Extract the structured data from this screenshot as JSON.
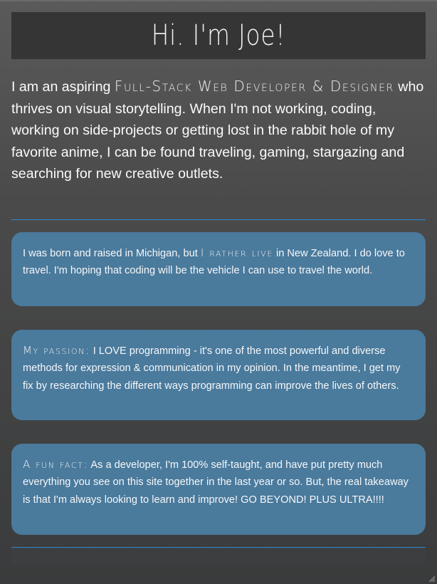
{
  "hero": {
    "title": "Hi. I'm Joe!"
  },
  "intro": {
    "text_before": "I am an aspiring ",
    "highlight": "Full-Stack Web Developer & Designer",
    "text_after": " who thrives on visual storytelling. When I'm not working, coding, working on side-projects or getting lost in the rabbit hole of my favorite anime, I can be found traveling, gaming, stargazing and searching for new creative outlets."
  },
  "cards": [
    {
      "text_before": "I was born and raised in Michigan, but ",
      "highlight": "I rather live",
      "text_after": " in New Zealand. I do love to travel. I'm hoping that coding will be the vehicle I can use to travel the world."
    },
    {
      "text_before": "",
      "highlight": "My passion:",
      "text_after": " I LOVE programming - it's one of the most powerful and diverse methods for expression & communication in my opinion. In the meantime, I get my fix by researching the different ways programming can improve the lives of others."
    },
    {
      "text_before": "",
      "highlight": "A fun fact:",
      "text_after": " As a developer, I'm 100% self-taught, and have put pretty much everything you see on this site together in the last year or so. But, the real takeaway is that I'm always looking to learn and improve! GO BEYOND! PLUS ULTRA!!!!"
    }
  ],
  "colors": {
    "accent_rule": "#2e8bd6",
    "card_bg": "#4a7a9c",
    "hero_bg": "#353535"
  }
}
